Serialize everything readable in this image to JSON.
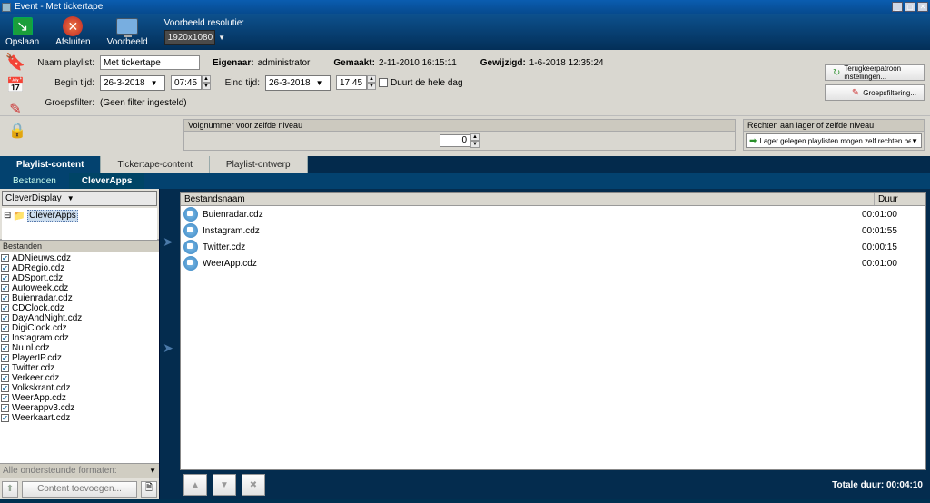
{
  "window": {
    "title": "Event - Met tickertape",
    "min": "_",
    "max": "▢",
    "close": "✕"
  },
  "toolbar": {
    "save": "Opslaan",
    "close": "Afsluiten",
    "preview": "Voorbeeld",
    "res_label": "Voorbeeld resolutie:",
    "res_value": "1920x1080"
  },
  "form": {
    "name_label": "Naam playlist:",
    "name_value": "Met tickertape",
    "owner_label": "Eigenaar:",
    "owner_value": "administrator",
    "created_label": "Gemaakt:",
    "created_value": "2-11-2010 16:15:11",
    "modified_label": "Gewijzigd:",
    "modified_value": "1-6-2018 12:35:24",
    "begin_label": "Begin tijd:",
    "begin_date": "26-3-2018",
    "begin_time": "07:45",
    "end_label": "Eind tijd:",
    "end_date": "26-3-2018",
    "end_time": "17:45",
    "allday_label": "Duurt de hele dag",
    "filter_label": "Groepsfilter:",
    "filter_value": "(Geen filter ingesteld)",
    "btn_pattern": "Terugkeerpatroon instellingen...",
    "btn_filter": "Groepsfiltering..."
  },
  "mid": {
    "volg_header": "Volgnummer voor zelfde niveau",
    "volg_value": "0",
    "recht_header": "Rechten aan lager of zelfde niveau",
    "recht_value": "Lager gelegen playlisten mogen zelf rechten bepalen"
  },
  "tabs": {
    "t1": "Playlist-content",
    "t2": "Tickertape-content",
    "t3": "Playlist-ontwerp",
    "sub1": "Bestanden",
    "sub2": "CleverApps"
  },
  "leftpanel": {
    "dd": "CleverDisplay",
    "folder": "CleverApps",
    "list_header": "Bestanden",
    "files": [
      "ADNieuws.cdz",
      "ADRegio.cdz",
      "ADSport.cdz",
      "Autoweek.cdz",
      "Buienradar.cdz",
      "CDClock.cdz",
      "DayAndNight.cdz",
      "DigiClock.cdz",
      "Instagram.cdz",
      "Nu.nl.cdz",
      "PlayerIP.cdz",
      "Twitter.cdz",
      "Verkeer.cdz",
      "Volkskrant.cdz",
      "WeerApp.cdz",
      "Weerappv3.cdz",
      "Weerkaart.cdz"
    ],
    "formats": "Alle ondersteunde formaten:",
    "add_btn": "Content toevoegen..."
  },
  "grid": {
    "col1": "Bestandsnaam",
    "col2": "Duur",
    "rows": [
      {
        "name": "Buienradar.cdz",
        "dur": "00:01:00"
      },
      {
        "name": "Instagram.cdz",
        "dur": "00:01:55"
      },
      {
        "name": "Twitter.cdz",
        "dur": "00:00:15"
      },
      {
        "name": "WeerApp.cdz",
        "dur": "00:01:00"
      }
    ],
    "total_label": "Totale duur:",
    "total_value": "00:04:10"
  },
  "icons": {
    "up": "▲",
    "down": "▼",
    "x": "✖",
    "right": "➤",
    "doc": "🗎"
  }
}
